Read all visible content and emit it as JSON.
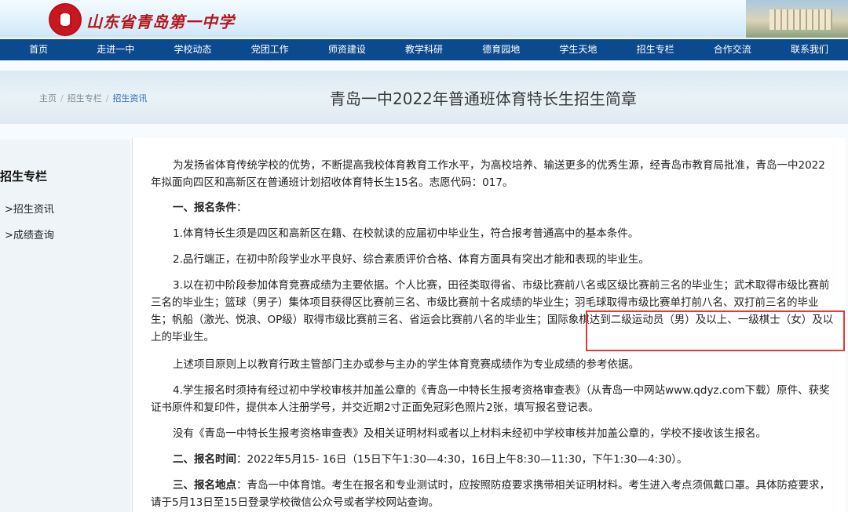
{
  "header": {
    "site_name": "山东省青岛第一中学"
  },
  "nav": {
    "items": [
      "首页",
      "走进一中",
      "学校动态",
      "党团工作",
      "师资建设",
      "教学科研",
      "德育园地",
      "学生天地",
      "招生专栏",
      "合作交流",
      "联系我们"
    ]
  },
  "breadcrumb": {
    "home": "主页",
    "section": "招生专栏",
    "current": "招生资讯"
  },
  "page_title": "青岛一中2022年普通班体育特长生招生简章",
  "sidebar": {
    "title": "招生专栏",
    "links": [
      ">招生资讯",
      ">成绩查询"
    ]
  },
  "article": {
    "intro": "为发扬省体育传统学校的优势，不断提高我校体育教育工作水平，为高校培养、输送更多的优秀生源，经青岛市教育局批准，青岛一中2022年拟面向四区和高新区在普通班计划招收体育特长生15名。志愿代码：017。",
    "sec1_heading": "一、报名条件",
    "sec1_colon": "：",
    "c1": "1.体育特长生须是四区和高新区在籍、在校就读的应届初中毕业生，符合报考普通高中的基本条件。",
    "c2": "2.品行端正，在初中阶段学业水平良好、综合素质评价合格、体育方面具有突出才能和表现的毕业生。",
    "c3": "3.以在初中阶段参加体育竞赛成绩为主要依据。个人比赛，田径类取得省、市级比赛前八名或区级比赛前三名的毕业生；武术取得市级比赛前三名的毕业生；篮球（男子）集体项目获得区比赛前三名、市级比赛前十名成绩的毕业生；羽毛球取得市级比赛单打前八名、双打前三名的毕业生；帆船（激光、悦浪、OP级）取得市级比赛前三名、省运会比赛前八名的毕业生；国际象棋达到二级运动员（男）及以上、一级棋士（女）及以上的毕业生。",
    "note": "上述项目原则上以教育行政主管部门主办或参与主办的学生体育竞赛成绩作为专业成绩的参考依据。",
    "c4": "4.学生报名时须持有经过初中学校审核并加盖公章的《青岛一中特长生报考资格审查表》（从青岛一中网站www.qdyz.com下载）原件、获奖证书原件和复印件，提供本人注册学号，并交近期2寸正面免冠彩色照片2张，填写报名登记表。",
    "warning": "没有《青岛一中特长生报考资格审查表》及相关证明材料或者以上材料未经初中学校审核并加盖公章的，学校不接收该生报名。",
    "sec2_heading": "二、报名时间",
    "sec2_text": "：2022年5月15- 16日（15日下午1:30—4:30，16日上午8:30—11:30，下午1:30—4:30）。",
    "sec3_heading": "三、报名地点",
    "sec3_text": "：青岛一中体育馆。考生在报名和专业测试时，应按照防疫要求携带相关证明材料。考生进入考点须佩戴口罩。具体防疫要求，请于5月13日至15日登录学校微信公众号或者学校网站查询。"
  },
  "colors": {
    "nav_bg": "#0c4a8f",
    "highlight_border": "#e53935",
    "brand_red": "#b4161c"
  }
}
